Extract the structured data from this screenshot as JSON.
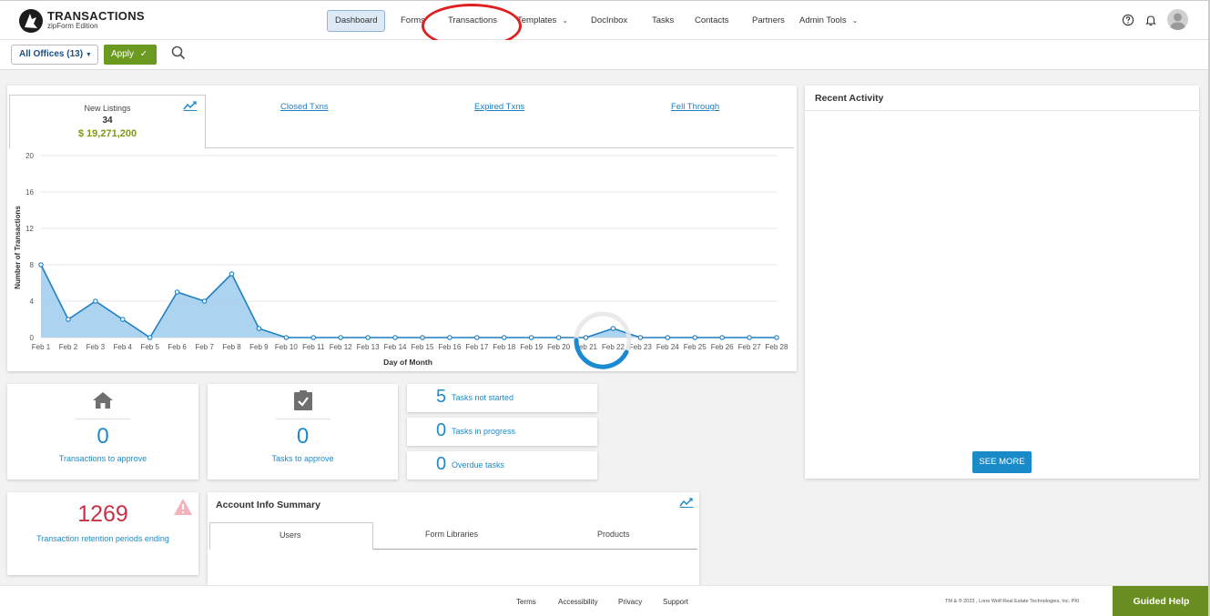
{
  "header": {
    "logo_title": "TRANSACTIONS",
    "logo_subtitle": "zipForm Edition",
    "nav": [
      {
        "label": "Dashboard"
      },
      {
        "label": "Forms"
      },
      {
        "label": "Transactions"
      },
      {
        "label": "Templates"
      },
      {
        "label": "DocInbox"
      },
      {
        "label": "Tasks"
      },
      {
        "label": "Contacts"
      },
      {
        "label": "Partners"
      },
      {
        "label": "Admin Tools"
      }
    ],
    "icons": [
      "help-icon",
      "bell-icon",
      "avatar-icon"
    ]
  },
  "filter": {
    "office_label": "All Offices (13)",
    "apply_label": "Apply"
  },
  "chart_panel": {
    "tabs": {
      "new_listings_label": "New Listings",
      "new_listings_count": "34",
      "new_listings_amount": "$ 19,271,200",
      "closed": "Closed Txns",
      "expired": "Expired Txns",
      "fell_through": "Fell Through"
    }
  },
  "chart_data": {
    "type": "area",
    "title": "",
    "xlabel": "Day of Month",
    "ylabel": "Number of Transactions",
    "ylim": [
      0,
      20
    ],
    "yticks": [
      "0",
      "4",
      "8",
      "12",
      "16",
      "20"
    ],
    "categories": [
      "Feb 1",
      "Feb 2",
      "Feb 3",
      "Feb 4",
      "Feb 5",
      "Feb 6",
      "Feb 7",
      "Feb 8",
      "Feb 9",
      "Feb 10",
      "Feb 11",
      "Feb 12",
      "Feb 13",
      "Feb 14",
      "Feb 15",
      "Feb 16",
      "Feb 17",
      "Feb 18",
      "Feb 19",
      "Feb 20",
      "Feb 21",
      "Feb 22",
      "Feb 23",
      "Feb 24",
      "Feb 25",
      "Feb 26",
      "Feb 27",
      "Feb 28"
    ],
    "series": [
      {
        "values": [
          8,
          2,
          4,
          2,
          0,
          5,
          4,
          7,
          1,
          0,
          0,
          0,
          0,
          0,
          0,
          0,
          0,
          0,
          0,
          0,
          0,
          1,
          0,
          0,
          0,
          0,
          0,
          0
        ]
      }
    ],
    "grid": true,
    "colors": {
      "line": "#1f7fc2",
      "fill": "#a8d1ee"
    }
  },
  "recent_activity": {
    "title": "Recent Activity",
    "see_more": "SEE MORE"
  },
  "cards": {
    "transactions_to_approve": {
      "count": "0",
      "label": "Transactions to approve"
    },
    "tasks_to_approve": {
      "count": "0",
      "label": "Tasks to approve"
    },
    "tasks_not_started": {
      "count": "5",
      "label": "Tasks not started"
    },
    "tasks_in_progress": {
      "count": "0",
      "label": "Tasks in progress"
    },
    "overdue_tasks": {
      "count": "0",
      "label": "Overdue tasks"
    },
    "retention": {
      "count": "1269",
      "label": "Transaction retention periods ending"
    }
  },
  "account_info": {
    "title": "Account Info Summary",
    "tabs": [
      "Users",
      "Form Libraries",
      "Products"
    ]
  },
  "footer": {
    "links": [
      "Terms",
      "Accessibility",
      "Privacy",
      "Support"
    ],
    "copyright": "TM & ® 2023 , Lone Wolf Real Estate Technologies, Inc. PKI",
    "guided_help": "Guided Help"
  },
  "colors": {
    "accent_blue": "#1e8ac8",
    "apply_green": "#6a9a1f",
    "retention_red": "#c83247",
    "annotation_red": "#e02020"
  }
}
